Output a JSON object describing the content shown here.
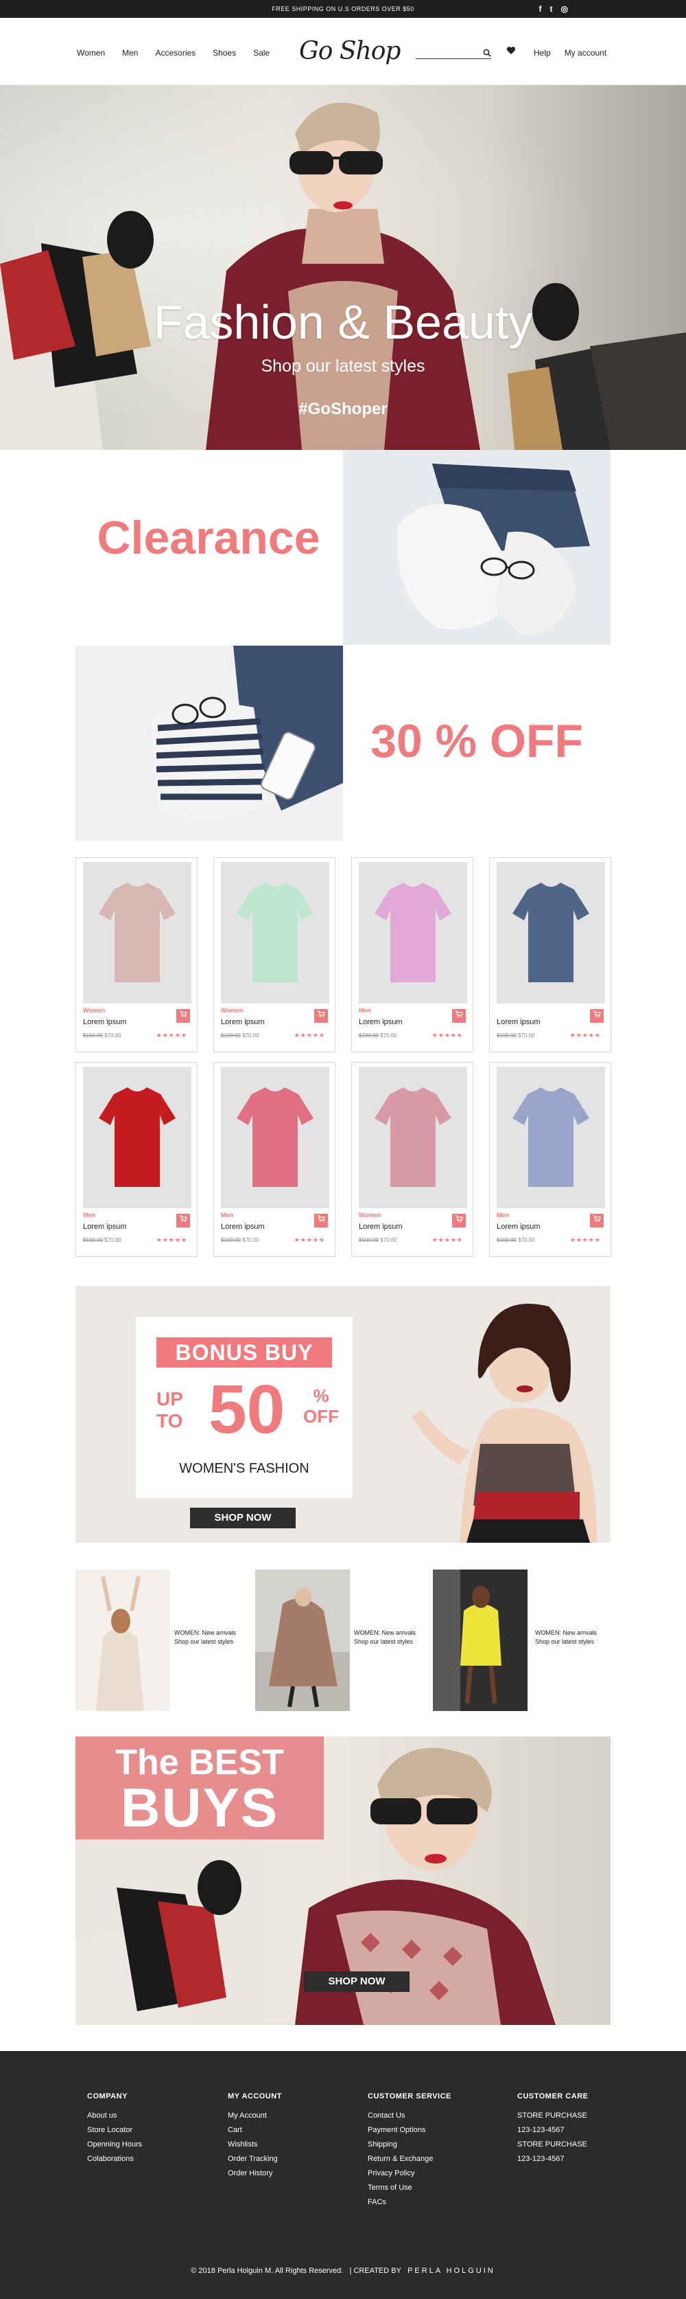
{
  "topbar": {
    "message": "FREE SHIPPING ON U.S ORDERS OVER $50",
    "social": [
      {
        "icon": "facebook-icon",
        "glyph": "f"
      },
      {
        "icon": "twitter-icon",
        "glyph": "t"
      },
      {
        "icon": "instagram-icon",
        "glyph": "◎"
      }
    ]
  },
  "header": {
    "logo": "Go Shop",
    "nav_left": [
      "Women",
      "Men",
      "Accesories",
      "Shoes",
      "Sale"
    ],
    "search_placeholder": "",
    "nav_right": [
      "Help",
      "My account"
    ]
  },
  "hero": {
    "title": "Fashion & Beauty",
    "subtitle": "Shop our latest styles",
    "hashtag": "#GoShoper"
  },
  "promo": {
    "clearance": "Clearance",
    "discount": "30 % OFF"
  },
  "products": [
    {
      "category": "Women",
      "name": "Lorem ipsum",
      "old_price": "$100.00",
      "price": "$70.00",
      "stars": "★★★★★",
      "color": "#d7b6b3"
    },
    {
      "category": "Women",
      "name": "Lorem ipsum",
      "old_price": "$100.00",
      "price": "$70.00",
      "stars": "★★★★★",
      "color": "#bfe6cf"
    },
    {
      "category": "Men",
      "name": "Lorem ipsum",
      "old_price": "$100.00",
      "price": "$70.00",
      "stars": "★★★★★",
      "color": "#e2a8d8"
    },
    {
      "category": "",
      "name": "Lorem ipsum",
      "old_price": "$100.00",
      "price": "$70.00",
      "stars": "★★★★★",
      "color": "#4f6688"
    },
    {
      "category": "Men",
      "name": "Lorem ipsum",
      "old_price": "$100.00",
      "price": "$70.00",
      "stars": "★★★★★",
      "color": "#c51d1f"
    },
    {
      "category": "Men",
      "name": "Lorem ipsum",
      "old_price": "$100.00",
      "price": "$70.00",
      "stars": "★★★★★",
      "color": "#e06f82"
    },
    {
      "category": "Women",
      "name": "Lorem ipsum",
      "old_price": "$100.00",
      "price": "$70.00",
      "stars": "★★★★★",
      "color": "#d99aa8"
    },
    {
      "category": "Men",
      "name": "Lorem ipsum",
      "old_price": "$100.00",
      "price": "$70.00",
      "stars": "★★★★★",
      "color": "#9aa3c8"
    }
  ],
  "bonus": {
    "title": "BONUS BUY",
    "up": "UP",
    "to": "TO",
    "amount": "50",
    "percent": "%",
    "off": "OFF",
    "subtitle": "WOMEN'S FASHION",
    "button": "SHOP NOW"
  },
  "arrivals": [
    {
      "line1": "WOMEN: New arrivals",
      "line2": "Shop our latest styles"
    },
    {
      "line1": "WOMEN: New arrivals",
      "line2": "Shop our latest styles"
    },
    {
      "line1": "WOMEN: New arrivals",
      "line2": "Shop our latest styles"
    }
  ],
  "best": {
    "line1": "The BEST",
    "line2": "BUYS",
    "button": "SHOP NOW"
  },
  "footer": {
    "columns": [
      {
        "title": "COMPANY",
        "links": [
          "About us",
          "Store Locator",
          "Openning Hours",
          "Colaborations"
        ]
      },
      {
        "title": "MY ACCOUNT",
        "links": [
          "My Account",
          "Cart",
          "Wishlists",
          "Order Tracking",
          "Order  History"
        ]
      },
      {
        "title": "CUSTOMER SERVICE",
        "links": [
          "Contact Us",
          "Payment Options",
          "Shipping",
          "Return & Exchange",
          "Privacy Policy",
          "Terms of Use",
          "FACs"
        ]
      },
      {
        "title": "CUSTOMER CARE",
        "links": [
          "STORE PURCHASE",
          "123-123-4567",
          "STORE PURCHASE",
          "123-123-4567"
        ]
      }
    ],
    "copyright": "© 2018 Perla Holguin M. All Rights Reserved.",
    "created_by": "| CREATED BY",
    "author": "PERLA HOLGUIN"
  },
  "colors": {
    "accent": "#ef7b7e",
    "dark": "#2b2b2b",
    "topbar": "#1f1f1f"
  }
}
